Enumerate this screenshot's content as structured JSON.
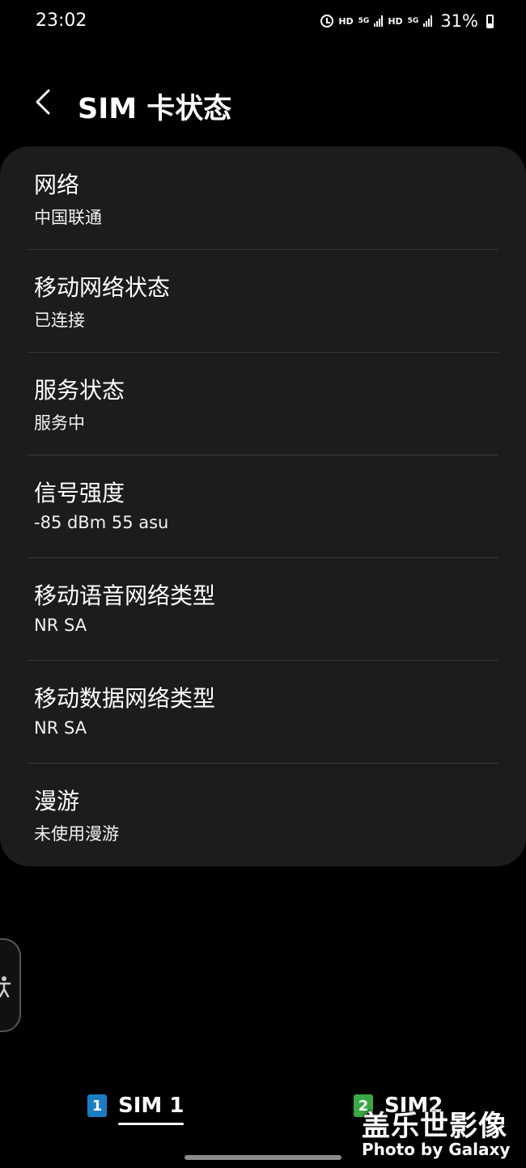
{
  "status_bar": {
    "time": "23:02",
    "hd1": "HD",
    "fiveg1": "5G",
    "hd2": "HD",
    "fiveg2": "5G",
    "battery": "31%",
    "icons": [
      "alarm-icon",
      "hd-icon",
      "signal-icon",
      "hd-icon",
      "signal-icon",
      "battery-icon"
    ]
  },
  "header": {
    "title": "SIM 卡状态",
    "back_icon": "chevron-left-icon"
  },
  "items": [
    {
      "label": "网络",
      "value": "中国联通"
    },
    {
      "label": "移动网络状态",
      "value": "已连接"
    },
    {
      "label": "服务状态",
      "value": "服务中"
    },
    {
      "label": "信号强度",
      "value": "-85 dBm 55 asu"
    },
    {
      "label": "移动语音网络类型",
      "value": "NR SA"
    },
    {
      "label": "移动数据网络类型",
      "value": "NR SA"
    },
    {
      "label": "漫游",
      "value": "未使用漫游"
    }
  ],
  "sim_tabs": [
    {
      "badge": "1",
      "label": "SIM 1",
      "selected": true,
      "color": "#1a7cc4"
    },
    {
      "badge": "2",
      "label": "SIM2",
      "selected": false,
      "color": "#3aa842"
    }
  ],
  "watermark": {
    "cn": "盖乐世影像",
    "en": "Photo by Galaxy"
  },
  "colors": {
    "background": "#000000",
    "card": "#1c1c1c",
    "divider": "#3a3a3a"
  }
}
